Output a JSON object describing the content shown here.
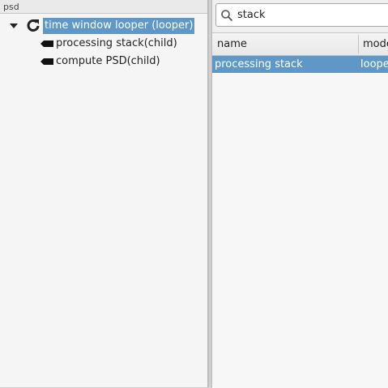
{
  "tree": {
    "header": "psd",
    "root": {
      "label": "time window looper (looper)",
      "icon": "refresh-icon"
    },
    "children": [
      {
        "label": "processing stack(child)",
        "icon": "tag-icon"
      },
      {
        "label": "compute PSD(child)",
        "icon": "tag-icon"
      }
    ]
  },
  "search": {
    "value": "stack"
  },
  "table": {
    "columns": [
      "name",
      "mode"
    ],
    "rows": [
      {
        "name": "processing stack",
        "mode": "looper"
      }
    ]
  },
  "colors": {
    "selection": "#5f98c6"
  }
}
